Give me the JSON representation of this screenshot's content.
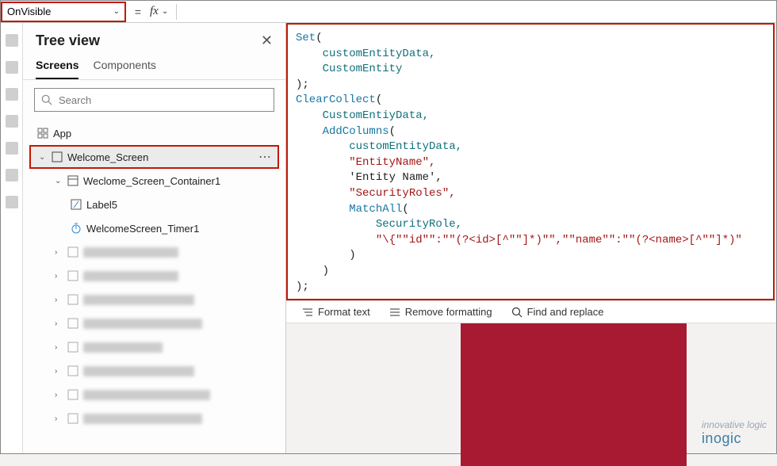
{
  "topbar": {
    "property": "OnVisible",
    "fx_label": "fx"
  },
  "tree": {
    "title": "Tree view",
    "tabs": {
      "screens": "Screens",
      "components": "Components"
    },
    "search_placeholder": "Search",
    "app_label": "App",
    "selected": "Welcome_Screen",
    "child1": "Weclome_Screen_Container1",
    "child2": "Label5",
    "child3": "WelcomeScreen_Timer1"
  },
  "formula": {
    "line1_fn": "Set",
    "line1_open": "(",
    "line2": "    customEntityData,",
    "line3": "    CustomEntity",
    "line4": ");",
    "line5_fn": "ClearCollect",
    "line5_open": "(",
    "line6": "    CustomEntiyData,",
    "line7_fn": "    AddColumns",
    "line7_open": "(",
    "line8": "        customEntityData,",
    "line9": "        \"EntityName\",",
    "line10": "        'Entity Name',",
    "line11": "        \"SecurityRoles\",",
    "line12_fn": "        MatchAll",
    "line12_open": "(",
    "line13": "            SecurityRole,",
    "line14": "            \"\\{\"\"id\"\":\"\"(?<id>[^\"\"]*)\"\",\"\"name\"\":\"\"(?<name>[^\"\"]*)\"",
    "line15": "        )",
    "line16": "    )",
    "line17": ");"
  },
  "toolbar": {
    "format": "Format text",
    "remove": "Remove formatting",
    "find": "Find and replace"
  },
  "watermark": {
    "tag": "innovative logic",
    "brand": "inogic"
  }
}
